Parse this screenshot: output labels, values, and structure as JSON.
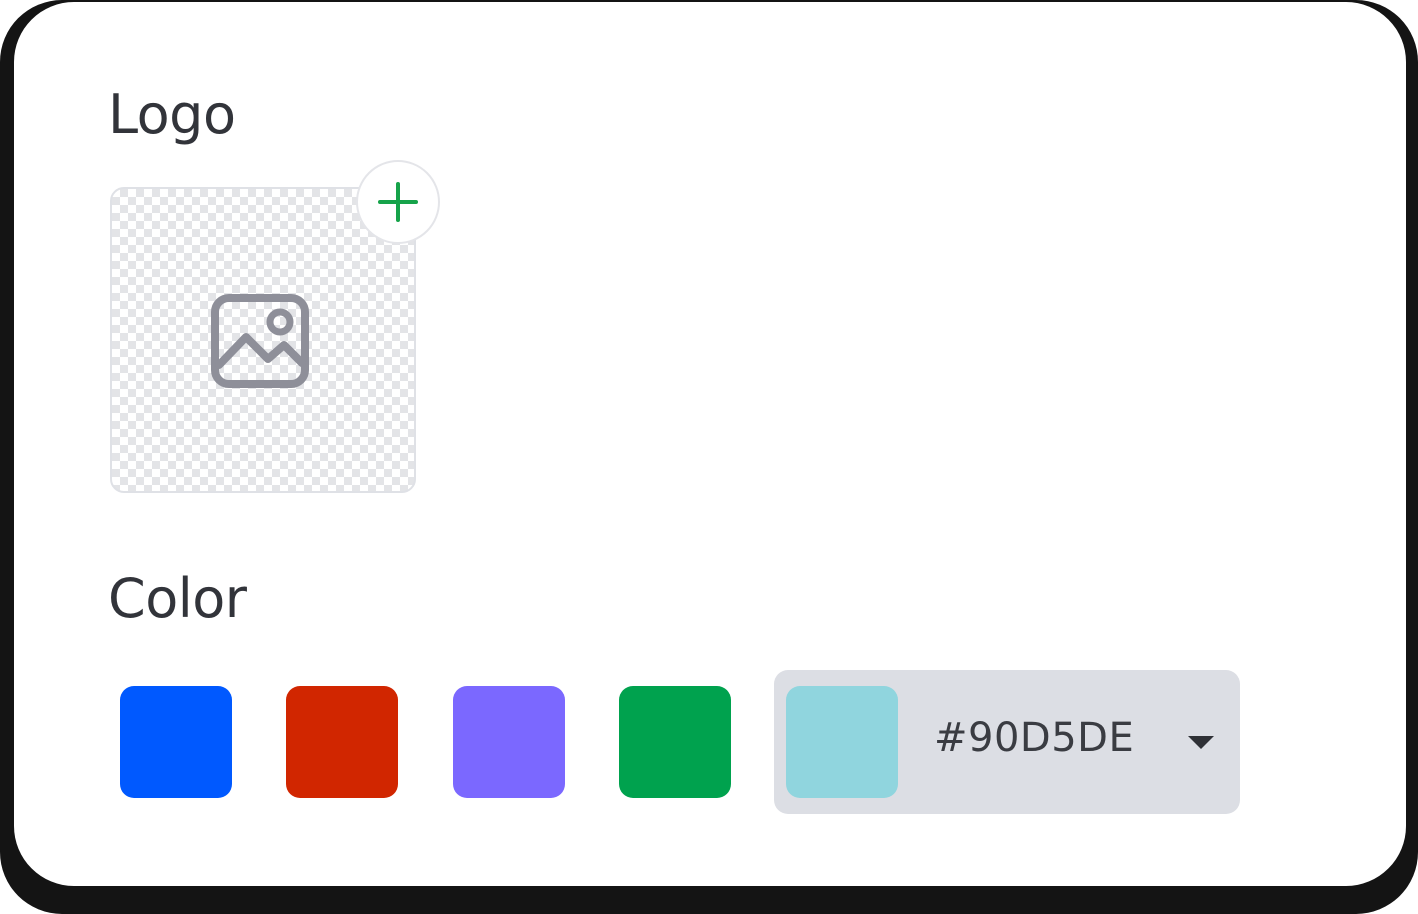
{
  "logo_section": {
    "title": "Logo",
    "add_icon": "plus-icon",
    "placeholder_icon": "image-icon",
    "add_icon_color": "#16a34a",
    "placeholder_icon_color": "#8e8f99"
  },
  "color_section": {
    "title": "Color",
    "swatches": [
      {
        "color": "#0059ff"
      },
      {
        "color": "#d12600"
      },
      {
        "color": "#7b68ff"
      },
      {
        "color": "#00a24e"
      }
    ],
    "custom": {
      "color": "#90d5de",
      "hex": "#90D5DE",
      "dropdown_icon": "caret-down-icon"
    }
  }
}
